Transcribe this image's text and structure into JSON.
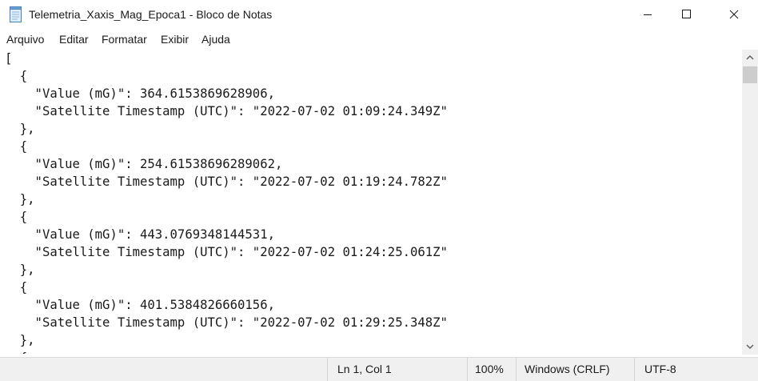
{
  "window": {
    "title": "Telemetria_Xaxis_Mag_Epoca1 - Bloco de Notas",
    "icon": "notepad-icon"
  },
  "menu": {
    "items": [
      "Arquivo",
      "Editar",
      "Formatar",
      "Exibir",
      "Ajuda"
    ]
  },
  "editor": {
    "lines": [
      "[",
      "  {",
      "    \"Value (mG)\": 364.6153869628906,",
      "    \"Satellite Timestamp (UTC)\": \"2022-07-02 01:09:24.349Z\"",
      "  },",
      "  {",
      "    \"Value (mG)\": 254.61538696289062,",
      "    \"Satellite Timestamp (UTC)\": \"2022-07-02 01:19:24.782Z\"",
      "  },",
      "  {",
      "    \"Value (mG)\": 443.0769348144531,",
      "    \"Satellite Timestamp (UTC)\": \"2022-07-02 01:24:25.061Z\"",
      "  },",
      "  {",
      "    \"Value (mG)\": 401.5384826660156,",
      "    \"Satellite Timestamp (UTC)\": \"2022-07-02 01:29:25.348Z\"",
      "  },",
      "  {"
    ]
  },
  "status": {
    "position": "Ln 1, Col 1",
    "zoom": "100%",
    "line_ending": "Windows (CRLF)",
    "encoding": "UTF-8"
  }
}
